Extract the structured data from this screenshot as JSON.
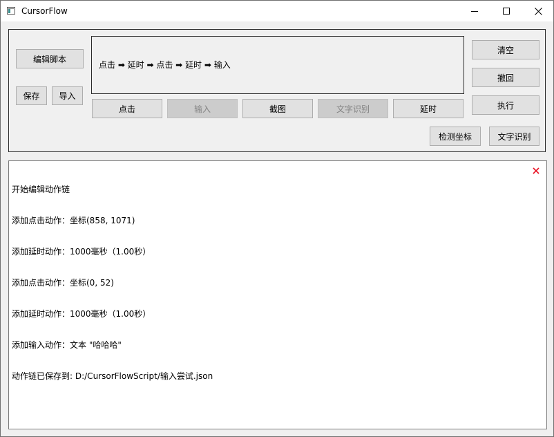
{
  "window": {
    "title": "CursorFlow"
  },
  "left_buttons": {
    "edit_script": "编辑脚本",
    "save": "保存",
    "import": "导入"
  },
  "chain": {
    "text": "点击 ➡ 延时 ➡ 点击 ➡ 延时 ➡ 输入"
  },
  "action_buttons": {
    "click": "点击",
    "input": "输入",
    "screenshot": "截图",
    "ocr": "文字识别",
    "delay": "延时"
  },
  "right_buttons": {
    "clear": "清空",
    "undo": "撤回",
    "execute": "执行",
    "detect_coords": "检测坐标",
    "ocr": "文字识别"
  },
  "log": {
    "lines": [
      "开始编辑动作链",
      "添加点击动作：坐标(858, 1071)",
      "添加延时动作：1000毫秒（1.00秒）",
      "添加点击动作：坐标(0, 52)",
      "添加延时动作：1000毫秒（1.00秒）",
      "添加输入动作：文本 \"哈哈哈\"",
      "动作链已保存到: D:/CursorFlowScript/输入尝试.json"
    ],
    "close_icon_color": "#e81123"
  }
}
